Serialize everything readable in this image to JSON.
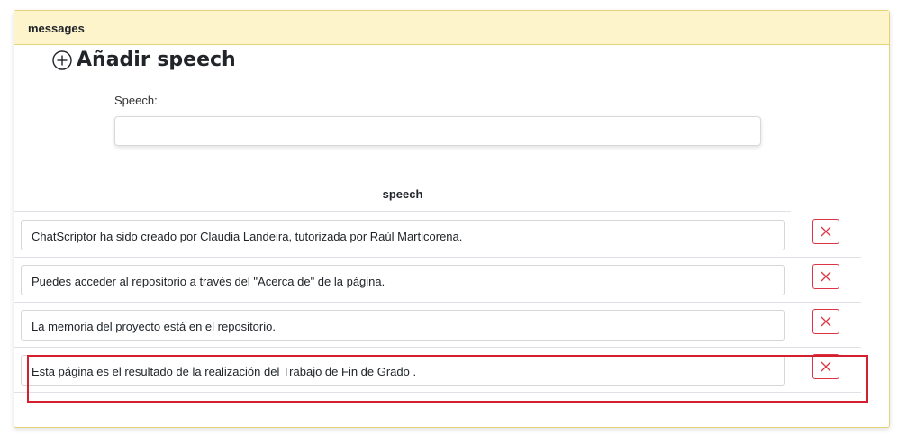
{
  "panel": {
    "title": "messages"
  },
  "add_section": {
    "title": "Añadir speech",
    "icon": "plus-circle-icon"
  },
  "form": {
    "label": "Speech:",
    "value": "",
    "placeholder": ""
  },
  "table": {
    "column_header": "speech",
    "rows": [
      {
        "text": "ChatScriptor ha sido creado por Claudia Landeira, tutorizada por Raúl Marticorena."
      },
      {
        "text": "Puedes acceder al repositorio a través del \"Acerca de\" de la página."
      },
      {
        "text": "La memoria del proyecto está en el repositorio."
      },
      {
        "text": "Esta página es el resultado de la realización del Trabajo de Fin de Grado ."
      }
    ],
    "delete_icon": "close-icon"
  },
  "colors": {
    "header_bg": "#fdf4cc",
    "border": "#e6d27a",
    "danger": "#dc3545",
    "highlight": "#d4202e"
  }
}
